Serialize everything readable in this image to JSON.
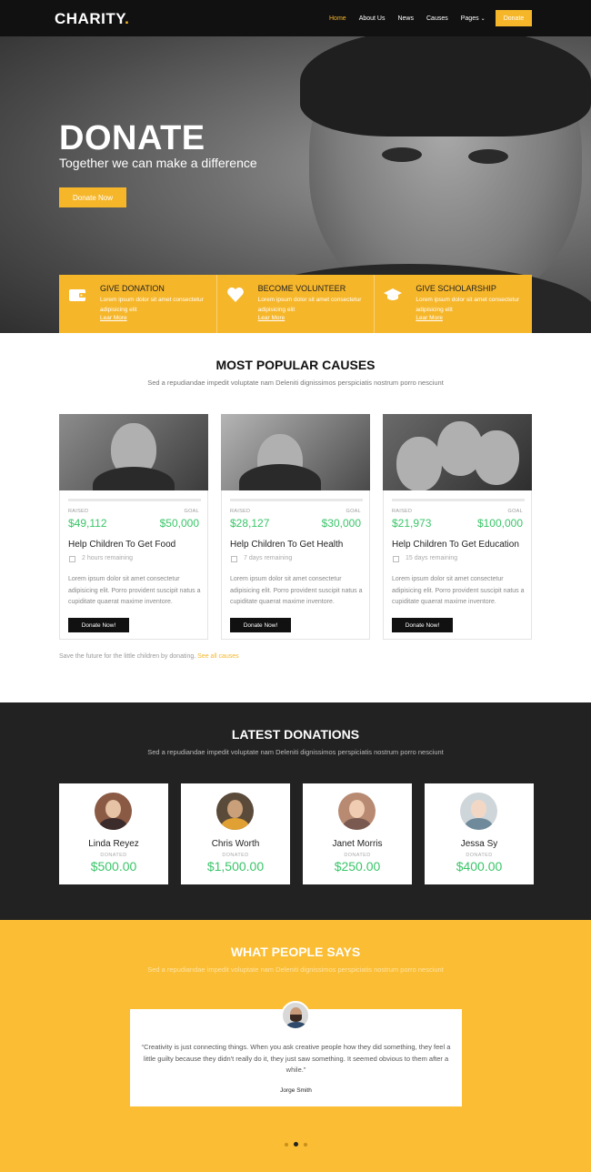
{
  "nav": {
    "brand": "CHARITY",
    "brand_dot": ".",
    "items": [
      "Home",
      "About Us",
      "News",
      "Causes",
      "Pages"
    ],
    "donate": "Donate"
  },
  "hero": {
    "title": "DONATE",
    "tagline": "Together we can make a difference",
    "button": "Donate Now"
  },
  "features": [
    {
      "title": "GIVE DONATION",
      "text": "Lorem ipsum dolor sit amet consectetur adipisicing elit",
      "link": "Lear More",
      "icon": "wallet-icon"
    },
    {
      "title": "BECOME VOLUNTEER",
      "text": "Lorem ipsum dolor sit amet consectetur adipisicing elit",
      "link": "Lear More",
      "icon": "heart-icon"
    },
    {
      "title": "GIVE SCHOLARSHIP",
      "text": "Lorem ipsum dolor sit amet consectetur adipisicing elit",
      "link": "Lear More",
      "icon": "graduation-cap-icon"
    }
  ],
  "causes": {
    "title": "MOST POPULAR CAUSES",
    "subtitle": "Sed a repudiandae impedit voluptate nam Deleniti dignissimos perspiciatis nostrum porro nesciunt",
    "raised_label": "RAISED",
    "goal_label": "GOAL",
    "button": "Donate Now!",
    "text": "Lorem ipsum dolor sit amet consectetur adipisicing elit. Porro provident suscipit natus a cupiditate quaerat maxime inventore.",
    "items": [
      {
        "raised": "$49,112",
        "goal": "$50,000",
        "title": "Help Children To Get Food",
        "time": "2 hours remaining"
      },
      {
        "raised": "$28,127",
        "goal": "$30,000",
        "title": "Help Children To Get Health",
        "time": "7 days remaining"
      },
      {
        "raised": "$21,973",
        "goal": "$100,000",
        "title": "Help Children To Get Education",
        "time": "15 days remaining"
      }
    ],
    "footer_text": "Save the future for the little children by donating.",
    "footer_link": "See all causes"
  },
  "donations": {
    "title": "LATEST DONATIONS",
    "subtitle": "Sed a repudiandae impedit voluptate nam Deleniti dignissimos perspiciatis nostrum porro nesciunt",
    "label": "DONATED",
    "items": [
      {
        "name": "Linda Reyez",
        "amount": "$500.00"
      },
      {
        "name": "Chris Worth",
        "amount": "$1,500.00"
      },
      {
        "name": "Janet Morris",
        "amount": "$250.00"
      },
      {
        "name": "Jessa Sy",
        "amount": "$400.00"
      }
    ]
  },
  "testimonials": {
    "title": "WHAT PEOPLE SAYS",
    "subtitle": "Sed a repudiandae impedit voluptate nam Deleniti dignissimos perspiciatis nostrum porro nesciunt",
    "quote": "“Creativity is just connecting things. When you ask creative people how they did something, they feel a little guilty because they didn't really do it, they just saw something. It seemed obvious to them after a while.”",
    "author": "Jorge Smith"
  },
  "colors": {
    "accent": "#f6b62a",
    "green": "#3ac569",
    "dark": "#222222"
  }
}
